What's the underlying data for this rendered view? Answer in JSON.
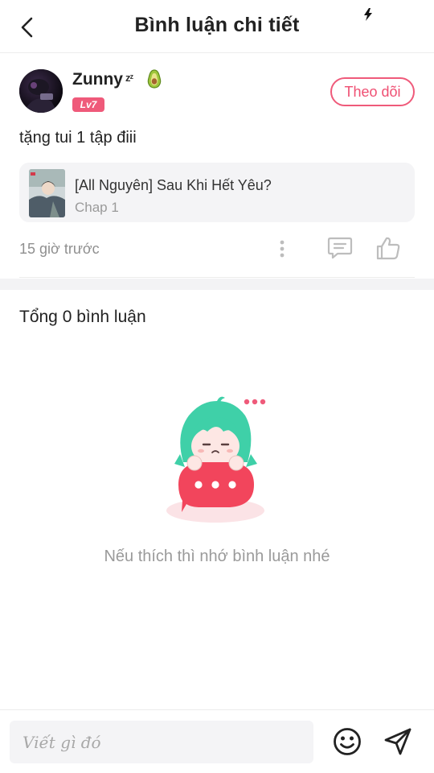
{
  "header": {
    "title": "Bình luận chi tiết"
  },
  "comment": {
    "user_name": "Zunny",
    "sleep_badge": "zᶻ",
    "level": "Lv7",
    "follow_label": "Theo dõi",
    "text": "tặng tui 1 tập điii",
    "chapter": {
      "title": "[All Nguyên] Sau Khi Hết Yêu?",
      "subtitle": "Chap 1"
    },
    "time": "15 giờ trước"
  },
  "replies": {
    "total_label": "Tổng 0 bình luận",
    "empty_message": "Nếu thích thì nhớ bình luận nhé"
  },
  "input": {
    "placeholder": "Viết gì đó",
    "value": ""
  },
  "colors": {
    "accent": "#ef5a7a",
    "badge": "#ef5a7a",
    "text_primary": "#222222",
    "text_secondary": "#9a9a9a",
    "icon_gray": "#bdbdbd"
  },
  "icons": {
    "back": "chevron-left-icon",
    "flash": "flash-icon",
    "avocado": "avocado-icon",
    "more": "more-vertical-icon",
    "reply": "comment-icon",
    "like": "thumbs-up-icon",
    "emoji": "smile-icon",
    "send": "send-icon"
  }
}
